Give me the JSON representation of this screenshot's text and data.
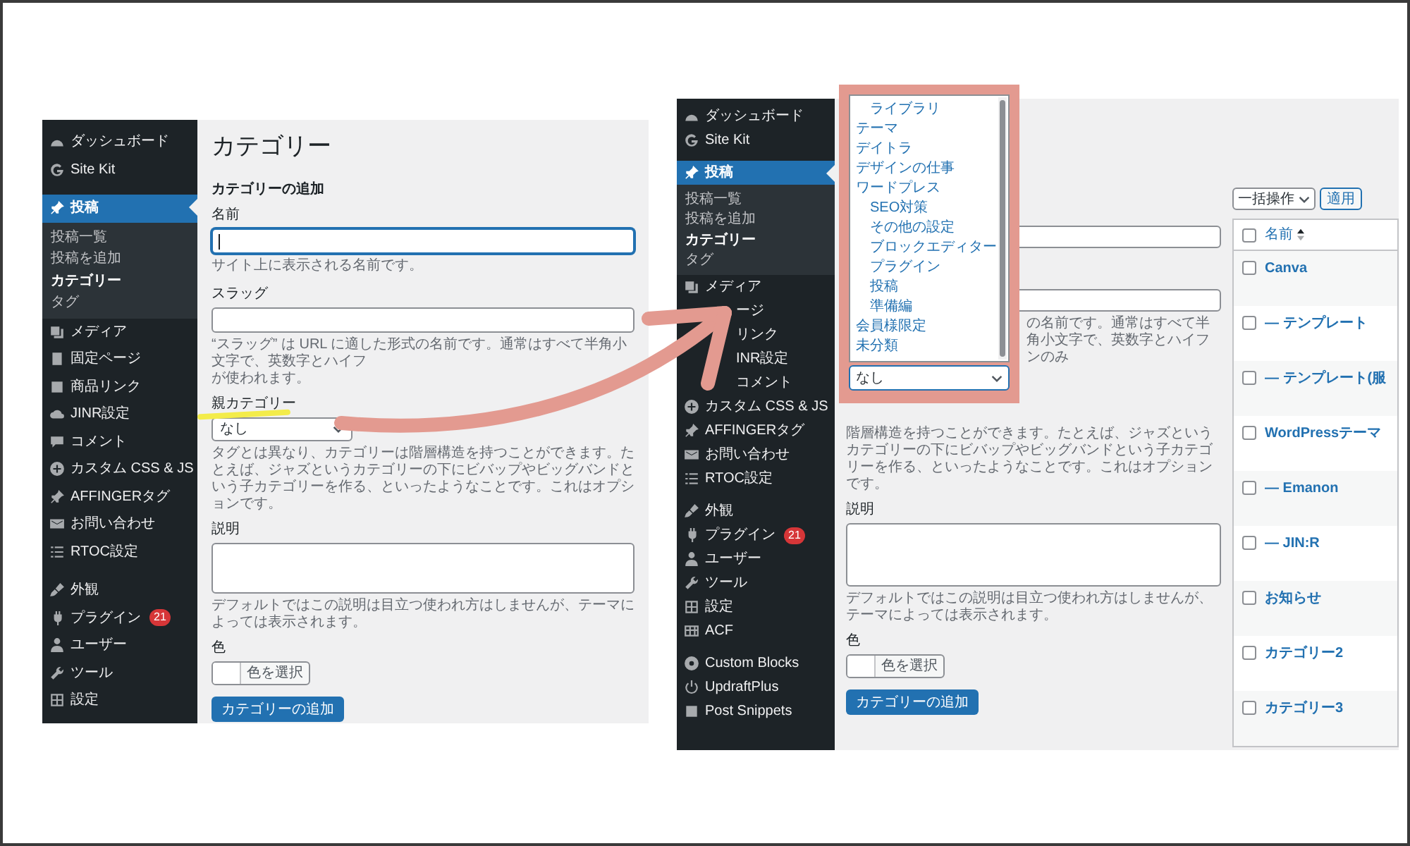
{
  "left_screen": {
    "sidebar": {
      "sections": [
        {
          "items": [
            {
              "label": "ダッシュボード",
              "selected": false
            },
            {
              "label": "Site Kit",
              "selected": false
            }
          ]
        },
        {
          "items": [
            {
              "label": "投稿",
              "selected": true,
              "children": [
                {
                  "label": "投稿一覧",
                  "selected": false
                },
                {
                  "label": "投稿を追加",
                  "selected": false
                },
                {
                  "label": "カテゴリー",
                  "selected": true
                },
                {
                  "label": "タグ",
                  "selected": false
                }
              ]
            },
            {
              "label": "メディア",
              "selected": false
            },
            {
              "label": "固定ページ",
              "selected": false
            },
            {
              "label": "商品リンク",
              "selected": false
            },
            {
              "label": "JINR設定",
              "selected": false
            },
            {
              "label": "コメント",
              "selected": false
            },
            {
              "label": "カスタム CSS & JS",
              "selected": false
            },
            {
              "label": "AFFINGERタグ",
              "selected": false
            },
            {
              "label": "お問い合わせ",
              "selected": false
            },
            {
              "label": "RTOC設定",
              "selected": false
            }
          ]
        },
        {
          "items": [
            {
              "label": "外観",
              "selected": false
            },
            {
              "label": "プラグイン",
              "selected": false,
              "badge": "21"
            },
            {
              "label": "ユーザー",
              "selected": false
            },
            {
              "label": "ツール",
              "selected": false
            },
            {
              "label": "設定",
              "selected": false
            }
          ]
        }
      ]
    },
    "page_title": "カテゴリー",
    "form": {
      "heading": "カテゴリーの追加",
      "name_label": "名前",
      "name_field": {
        "focused": true
      },
      "name_help": "サイト上に表示される名前です。",
      "slug_label": "スラッグ",
      "slug_help": [
        "“スラッグ” は URL に適した形式の名前です。通常はすべて半角小文字で、英数字とハイフ",
        "が使われます。"
      ],
      "parent_label": "親カテゴリー",
      "parent_select": {
        "value": "なし"
      },
      "parent_help": "タグとは異なり、カテゴリーは階層構造を持つことができます。たとえば、ジャズというカテゴリーの下にビバップやビッグバンドという子カテゴリーを作る、といったようなことです。これはオプションです。",
      "description_label": "説明",
      "description_help": "デフォルトではこの説明は目立つ使われ方はしませんが、テーマによっては表示されます。",
      "color_label": "色",
      "color_button": "色を選択",
      "submit_button": "カテゴリーの追加"
    }
  },
  "right_screen": {
    "sidebar": {
      "sections": [
        {
          "items": [
            {
              "label": "ダッシュボード",
              "selected": false
            },
            {
              "label": "Site Kit",
              "selected": false
            }
          ]
        },
        {
          "items": [
            {
              "label": "投稿",
              "selected": true,
              "children": [
                {
                  "label": "投稿一覧",
                  "selected": false
                },
                {
                  "label": "投稿を追加",
                  "selected": false
                },
                {
                  "label": "カテゴリー",
                  "selected": true
                },
                {
                  "label": "タグ",
                  "selected": false
                }
              ]
            },
            {
              "label": "メディア",
              "selected": false
            },
            {
              "label": "ージ",
              "selected": false
            },
            {
              "label": "リンク",
              "selected": false
            },
            {
              "label": "INR設定",
              "selected": false
            },
            {
              "label": "コメント",
              "selected": false
            },
            {
              "label": "カスタム CSS & JS",
              "selected": false
            },
            {
              "label": "AFFINGERタグ",
              "selected": false
            },
            {
              "label": "お問い合わせ",
              "selected": false
            },
            {
              "label": "RTOC設定",
              "selected": false
            }
          ]
        },
        {
          "items": [
            {
              "label": "外観",
              "selected": false
            },
            {
              "label": "プラグイン",
              "selected": false,
              "badge": "21"
            },
            {
              "label": "ユーザー",
              "selected": false
            },
            {
              "label": "ツール",
              "selected": false
            },
            {
              "label": "設定",
              "selected": false
            },
            {
              "label": "ACF",
              "selected": false
            }
          ]
        },
        {
          "items": [
            {
              "label": "Custom Blocks",
              "selected": false
            },
            {
              "label": "UpdraftPlus",
              "selected": false
            },
            {
              "label": "Post Snippets",
              "selected": false
            }
          ]
        }
      ]
    },
    "form": {
      "slug_help": "の名前です。通常はすべて半角小文字で、英数字とハイフンのみ",
      "parent_help": "階層構造を持つことができます。たとえば、ジャズというカテゴリーの下にビバップやビッグバンドという子カテゴリーを作る、といったようなことです。これはオプションです。",
      "description_label": "説明",
      "description_help": "デフォルトではこの説明は目立つ使われ方はしませんが、テーマによっては表示されます。",
      "color_label": "色",
      "color_button": "色を選択",
      "submit_button": "カテゴリーの追加"
    },
    "parent_dropdown": {
      "options": [
        {
          "children": [
            {
              "label": "ライブラリ"
            }
          ]
        },
        {
          "label": "テーマ"
        },
        {
          "label": "デイトラ"
        },
        {
          "label": "デザインの仕事"
        },
        {
          "label": "ワードプレス",
          "children": [
            {
              "label": "SEO対策"
            },
            {
              "label": "その他の設定"
            },
            {
              "label": "ブロックエディター"
            },
            {
              "label": "プラグイン"
            },
            {
              "label": "投稿"
            },
            {
              "label": "準備編"
            }
          ]
        },
        {
          "label": "会員様限定"
        },
        {
          "label": "未分類"
        }
      ],
      "value": "なし"
    },
    "table": {
      "bulk_action": "一括操作",
      "apply_button": "適用",
      "header": {
        "label": "名前",
        "checked": false
      },
      "rows": [
        {
          "name": "Canva",
          "checked": false
        },
        {
          "name": "— テンプレート",
          "checked": false
        },
        {
          "name": "— テンプレート(服",
          "checked": false
        },
        {
          "name": "WordPressテーマ",
          "checked": false
        },
        {
          "name": "— Emanon",
          "checked": false
        },
        {
          "name": "— JIN:R",
          "checked": false
        },
        {
          "name": "お知らせ",
          "checked": false
        },
        {
          "name": "カテゴリー2",
          "checked": false
        },
        {
          "name": "カテゴリー3",
          "checked": false
        }
      ]
    }
  }
}
